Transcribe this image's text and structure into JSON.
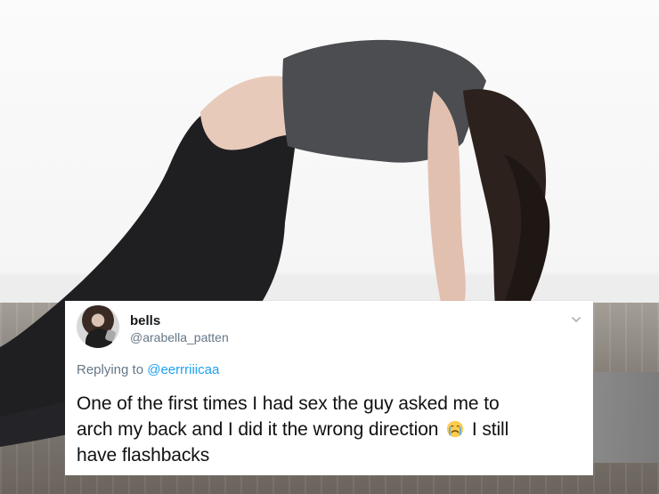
{
  "tweet": {
    "display_name": "bells",
    "handle": "@arabella_patten",
    "replying_prefix": "Replying to",
    "replying_handle": "@eerrriiicaa",
    "text_line1": "One of the first times I had sex the guy asked me to",
    "text_line2_before": "arch my back and I did it the wrong direction",
    "emoji": "crying-face-icon",
    "text_line2_after": "I still",
    "text_line3": "have flashbacks"
  }
}
